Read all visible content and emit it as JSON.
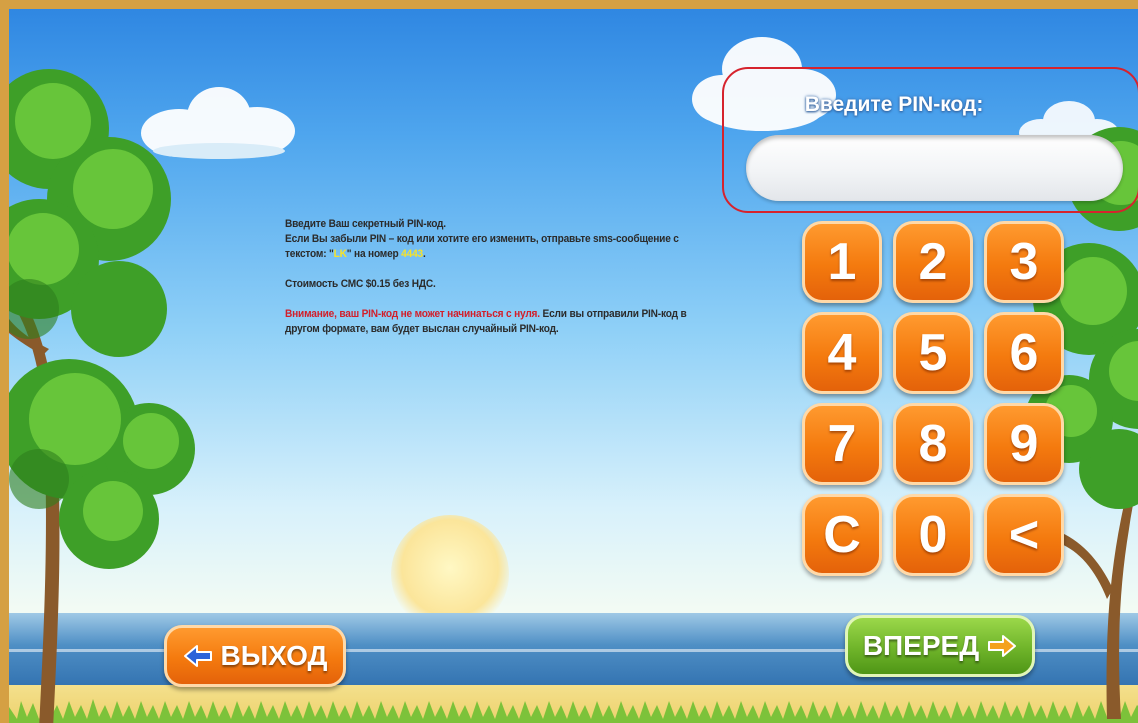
{
  "pin": {
    "label": "Введите PIN-код:",
    "value": ""
  },
  "info": {
    "line1": "Введите Ваш секретный PIN-код.",
    "line2_before": " Если Вы забыли PIN – код или хотите его изменить, отправьте sms-сообщение с текстом: \"",
    "sms_text": "LK",
    "line2_middle": "\" на номер ",
    "sms_number": "4443",
    "line2_after": ".",
    "cost": "Стоимость СМС $0.15 без НДС.",
    "warning": "Внимание, ваш PIN-код не может начинаться с нуля.",
    "warning_rest": " Если вы отправили PIN-код в другом формате, вам будет выслан случайный PIN-код."
  },
  "keypad": {
    "k1": "1",
    "k2": "2",
    "k3": "3",
    "k4": "4",
    "k5": "5",
    "k6": "6",
    "k7": "7",
    "k8": "8",
    "k9": "9",
    "clear": "C",
    "k0": "0",
    "backspace": "<"
  },
  "nav": {
    "exit_label": "ВЫХОД",
    "next_label": "ВПЕРЕД"
  },
  "colors": {
    "frame": "#d5a043",
    "key_orange": "#f47a0e",
    "next_green": "#6fb42a",
    "pin_outline": "#d6232d",
    "highlight_yellow": "#f6e32a",
    "warning_red": "#d21f2a"
  }
}
